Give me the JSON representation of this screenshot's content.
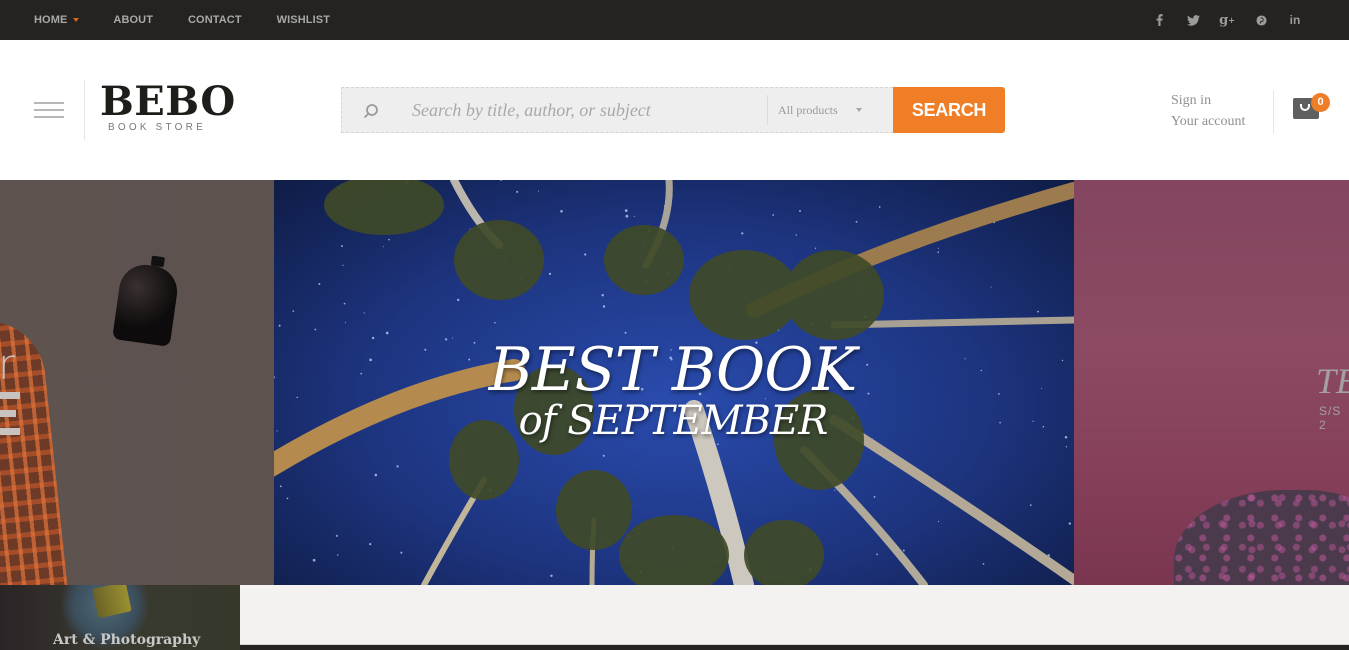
{
  "topbar": {
    "nav": [
      {
        "label": "HOME",
        "has_dropdown": true
      },
      {
        "label": "ABOUT"
      },
      {
        "label": "CONTACT"
      },
      {
        "label": "WISHLIST"
      }
    ],
    "social": [
      "facebook-icon",
      "twitter-icon",
      "google-plus-icon",
      "pinterest-icon",
      "linkedin-icon"
    ],
    "dropdown_accent": "#d2691e"
  },
  "header": {
    "logo": {
      "title": "BEBO",
      "subtitle": "BOOK STORE"
    },
    "search": {
      "placeholder": "Search by title, author, or subject",
      "value": "",
      "category": "All products",
      "button_label": "SEARCH"
    },
    "account": {
      "sign_in": "Sign in",
      "your_account": "Your account"
    },
    "cart": {
      "count": "0"
    },
    "accent_color": "#f07e26"
  },
  "slider": {
    "left_slide": {
      "text_fragment": "r"
    },
    "center_slide": {
      "line1": "BEST BOOK",
      "line2_prefix": "of",
      "line2": "SEPTEMBER"
    },
    "right_slide": {
      "title_fragment": "TE",
      "subtitle_fragment": "S/S 2"
    }
  },
  "categories": [
    {
      "label": "Art & Photography"
    }
  ]
}
